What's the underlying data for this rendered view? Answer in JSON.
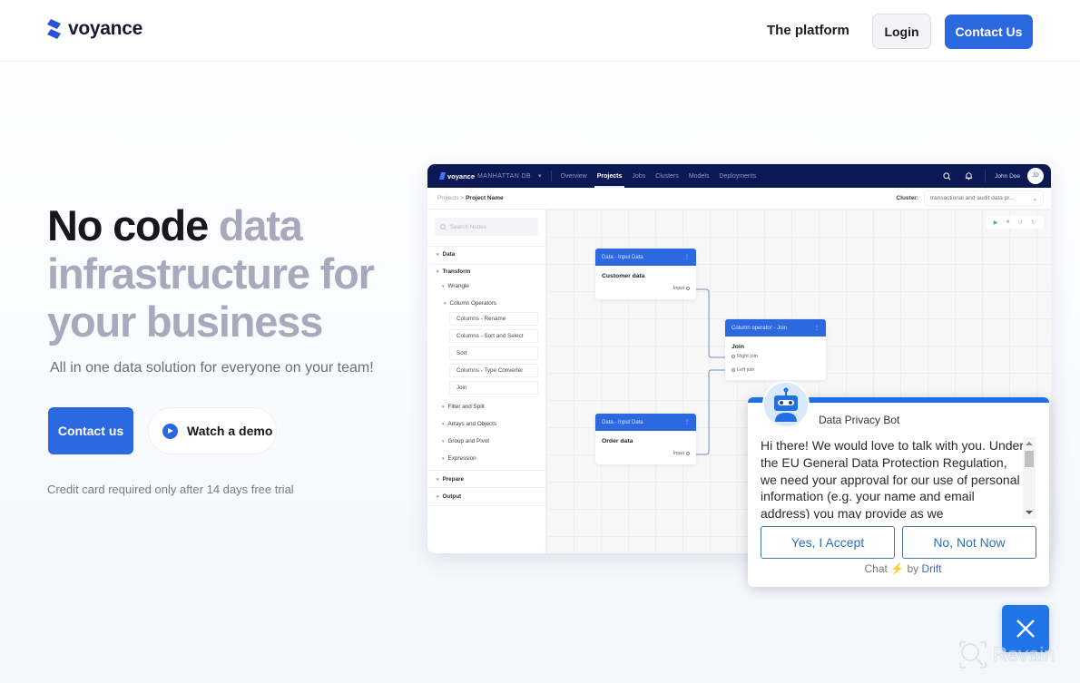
{
  "nav": {
    "logo_text": "voyance",
    "links": [
      "The platform"
    ],
    "login_label": "Login",
    "contact_label": "Contact Us",
    "brand_color": "#2c68e0"
  },
  "hero": {
    "title_dark": "No code",
    "title_light": "data infrastructure for your business",
    "subtitle": "All in one data solution for everyone on your team!",
    "primary_cta": "Contact us",
    "secondary_cta": "Watch a demo",
    "note": "Credit card required only after 14 days free trial"
  },
  "mockup": {
    "logo": "voyance",
    "workspace": "MANHATTAN DB",
    "tabs": [
      {
        "label": "Overview",
        "active": false
      },
      {
        "label": "Projects",
        "active": true
      },
      {
        "label": "Jobs",
        "active": false
      },
      {
        "label": "Clusters",
        "active": false
      },
      {
        "label": "Models",
        "active": false
      },
      {
        "label": "Deployments",
        "active": false
      }
    ],
    "user_name": "John Doe",
    "user_initials": "JD",
    "breadcrumb_root": "Projects",
    "breadcrumb_sep": ">",
    "breadcrumb_current": "Project Name",
    "cluster_label": "Cluster:",
    "cluster_value": "transactional and audit data pr...",
    "search_placeholder": "Search Nodes",
    "tree": {
      "data": "Data",
      "transform": "Transform",
      "wrangle": "Wrangle",
      "column_operators": "Column Operators",
      "leaves": [
        "Columns - Rename",
        "Columns - Sort and Select",
        "Sort",
        "Columns - Type Converter",
        "Join"
      ],
      "groups": [
        "Filter and Split",
        "Arrays and Objects",
        "Group and Pivot",
        "Expression"
      ],
      "prepare": "Prepare",
      "output": "Output"
    },
    "nodes": {
      "customer": {
        "header": "Data - Input Data",
        "title": "Customer data",
        "port": "Input"
      },
      "join": {
        "header": "Column operator - Join",
        "title": "Join",
        "port_right": "Right join",
        "port_left": "Left join"
      },
      "order": {
        "header": "Data - Input Data",
        "title": "Order data",
        "port": "Input"
      }
    }
  },
  "chat": {
    "bot_name": "Data Privacy Bot",
    "message": "Hi there! We would love to talk with you. Under the EU General Data Protection Regulation, we need your approval for our use of personal information (e.g. your name and email address) you may provide as we communicate:",
    "accept_label": "Yes, I Accept",
    "decline_label": "No, Not Now",
    "footer_chat": "Chat",
    "footer_by": "by",
    "footer_brand": "Drift",
    "accent_color": "#1f6fe5"
  },
  "watermark": "Revain"
}
